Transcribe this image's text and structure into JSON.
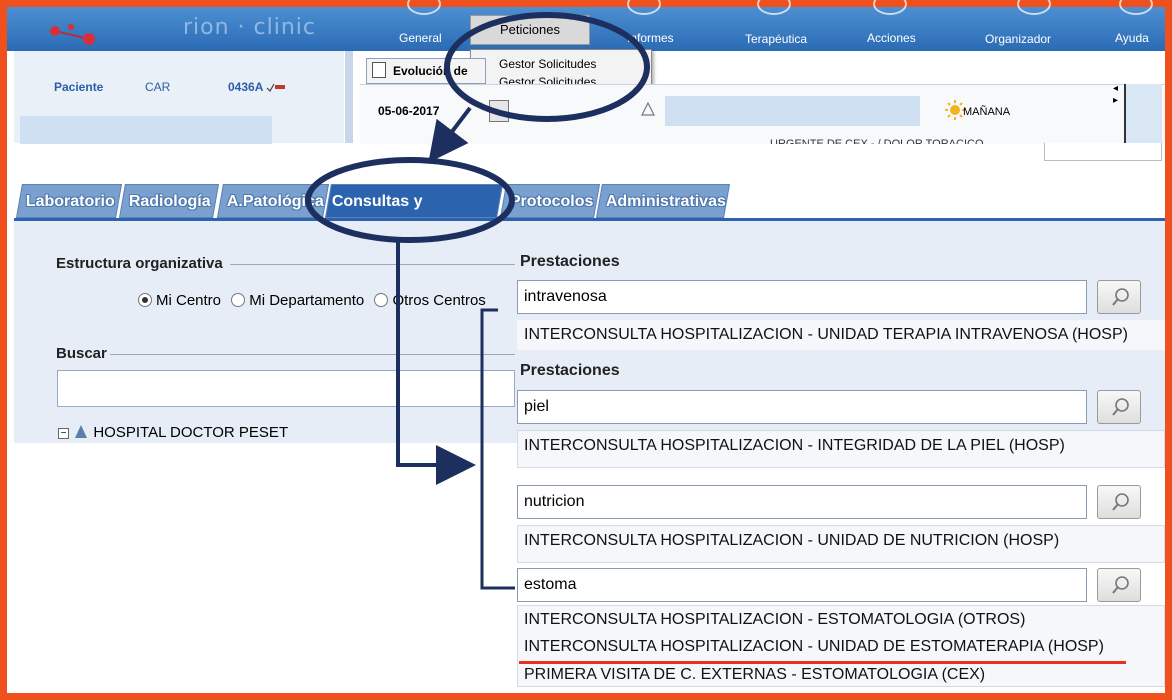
{
  "app": {
    "logo_text": "rion · clinic",
    "menu": [
      "General",
      "Peticiones",
      "Informes",
      "Terapéutica",
      "Acciones",
      "Organizador",
      "Ayuda"
    ],
    "dropdown_items": [
      "Gestor Solicitudes",
      "Gestor Solicitudes"
    ]
  },
  "patient": {
    "label": "Paciente",
    "car": "CAR",
    "id": "0436A"
  },
  "evolution": {
    "tab_label": "Evolución de",
    "date": "05-06-2017",
    "shift": "MAÑANA",
    "urgent_text": "URGENTE DE CEX - / DOLOR TORACICO"
  },
  "tabs": [
    "Laboratorio",
    "Radiología",
    "A.Patológica",
    "Consultas y técnicas",
    "Protocolos",
    "Administrativas"
  ],
  "left_panel": {
    "org_label": "Estructura organizativa",
    "radio_options": [
      "Mi Centro",
      "Mi Departamento",
      "Otros Centros"
    ],
    "search_label": "Buscar",
    "tree_item": "HOSPITAL DOCTOR PESET"
  },
  "prestaciones": {
    "title": "Prestaciones",
    "searches": [
      {
        "query": "intravenosa",
        "results": [
          "INTERCONSULTA HOSPITALIZACION - UNIDAD TERAPIA INTRAVENOSA (HOSP)"
        ]
      },
      {
        "query": "piel",
        "results": [
          "INTERCONSULTA HOSPITALIZACION - INTEGRIDAD DE LA PIEL (HOSP)"
        ]
      },
      {
        "query": "nutricion",
        "results": [
          "INTERCONSULTA HOSPITALIZACION - UNIDAD DE NUTRICION (HOSP)"
        ]
      },
      {
        "query": "estoma",
        "results": [
          "INTERCONSULTA HOSPITALIZACION - ESTOMATOLOGIA (OTROS)",
          "INTERCONSULTA HOSPITALIZACION - UNIDAD DE ESTOMATERAPIA (HOSP)",
          "PRIMERA VISITA DE C. EXTERNAS - ESTOMATOLOGIA (CEX)"
        ]
      }
    ]
  },
  "colors": {
    "border": "#f0501e",
    "annotation": "#1c2f5e",
    "accent_blue": "#2b63ae",
    "underline": "#e8301e"
  }
}
